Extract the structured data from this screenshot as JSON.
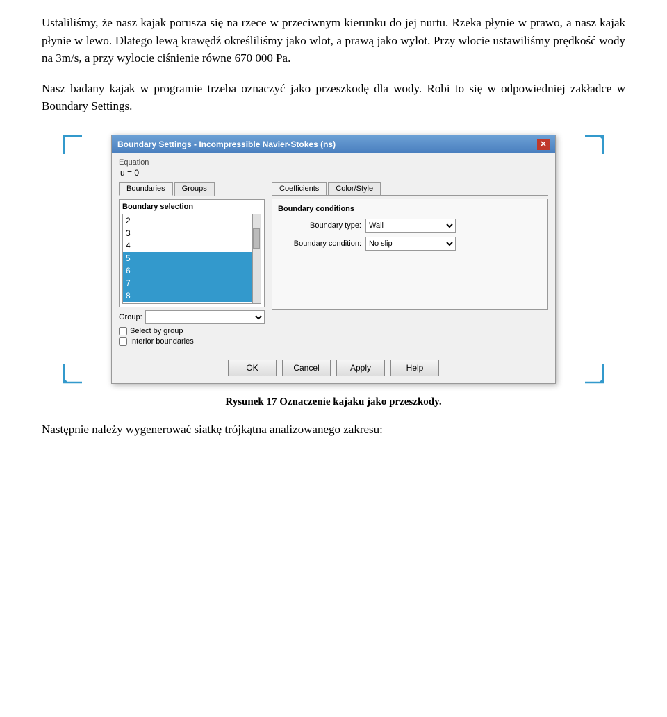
{
  "paragraphs": {
    "p1": "Ustaliliśmy, że nasz kajak porusza się na rzece w przeciwnym kierunku do jej nurtu. Rzeka płynie w prawo, a nasz kajak płynie w lewo. Dlatego lewą krawędź określiliśmy jako wlot, a prawą jako wylot. Przy wlocie ustawiliśmy prędkość wody na 3m/s, a przy wylocie ciśnienie równe 670 000 Pa.",
    "p2": "Nasz badany kajak w programie trzeba oznaczyć jako przeszkodę dla wody. Robi to się w odpowiedniej zakładce w Boundary Settings.",
    "caption": "Rysunek 17 Oznaczenie kajaku jako przeszkody.",
    "p3": "Następnie należy wygenerować siatkę trójkątna analizowanego zakresu:"
  },
  "dialog": {
    "title": "Boundary Settings - Incompressible Navier-Stokes (ns)",
    "close_btn": "✕",
    "equation_label": "Equation",
    "equation_value": "u = 0",
    "tabs_left": [
      "Boundaries",
      "Groups"
    ],
    "active_tab_left": "Boundaries",
    "panel_label": "Boundary selection",
    "boundary_items": [
      "2",
      "3",
      "4",
      "5",
      "6",
      "7",
      "8"
    ],
    "selected_items": [
      "5",
      "6",
      "7",
      "8"
    ],
    "group_label": "Group:",
    "select_by_group": "Select by group",
    "interior_boundaries": "Interior boundaries",
    "tabs_right": [
      "Coefficients",
      "Color/Style"
    ],
    "active_tab_right": "Coefficients",
    "conditions_title": "Boundary conditions",
    "boundary_type_label": "Boundary type:",
    "boundary_type_value": "Wall",
    "boundary_condition_label": "Boundary condition:",
    "boundary_condition_value": "No slip",
    "buttons": [
      "OK",
      "Cancel",
      "Apply",
      "Help"
    ]
  }
}
